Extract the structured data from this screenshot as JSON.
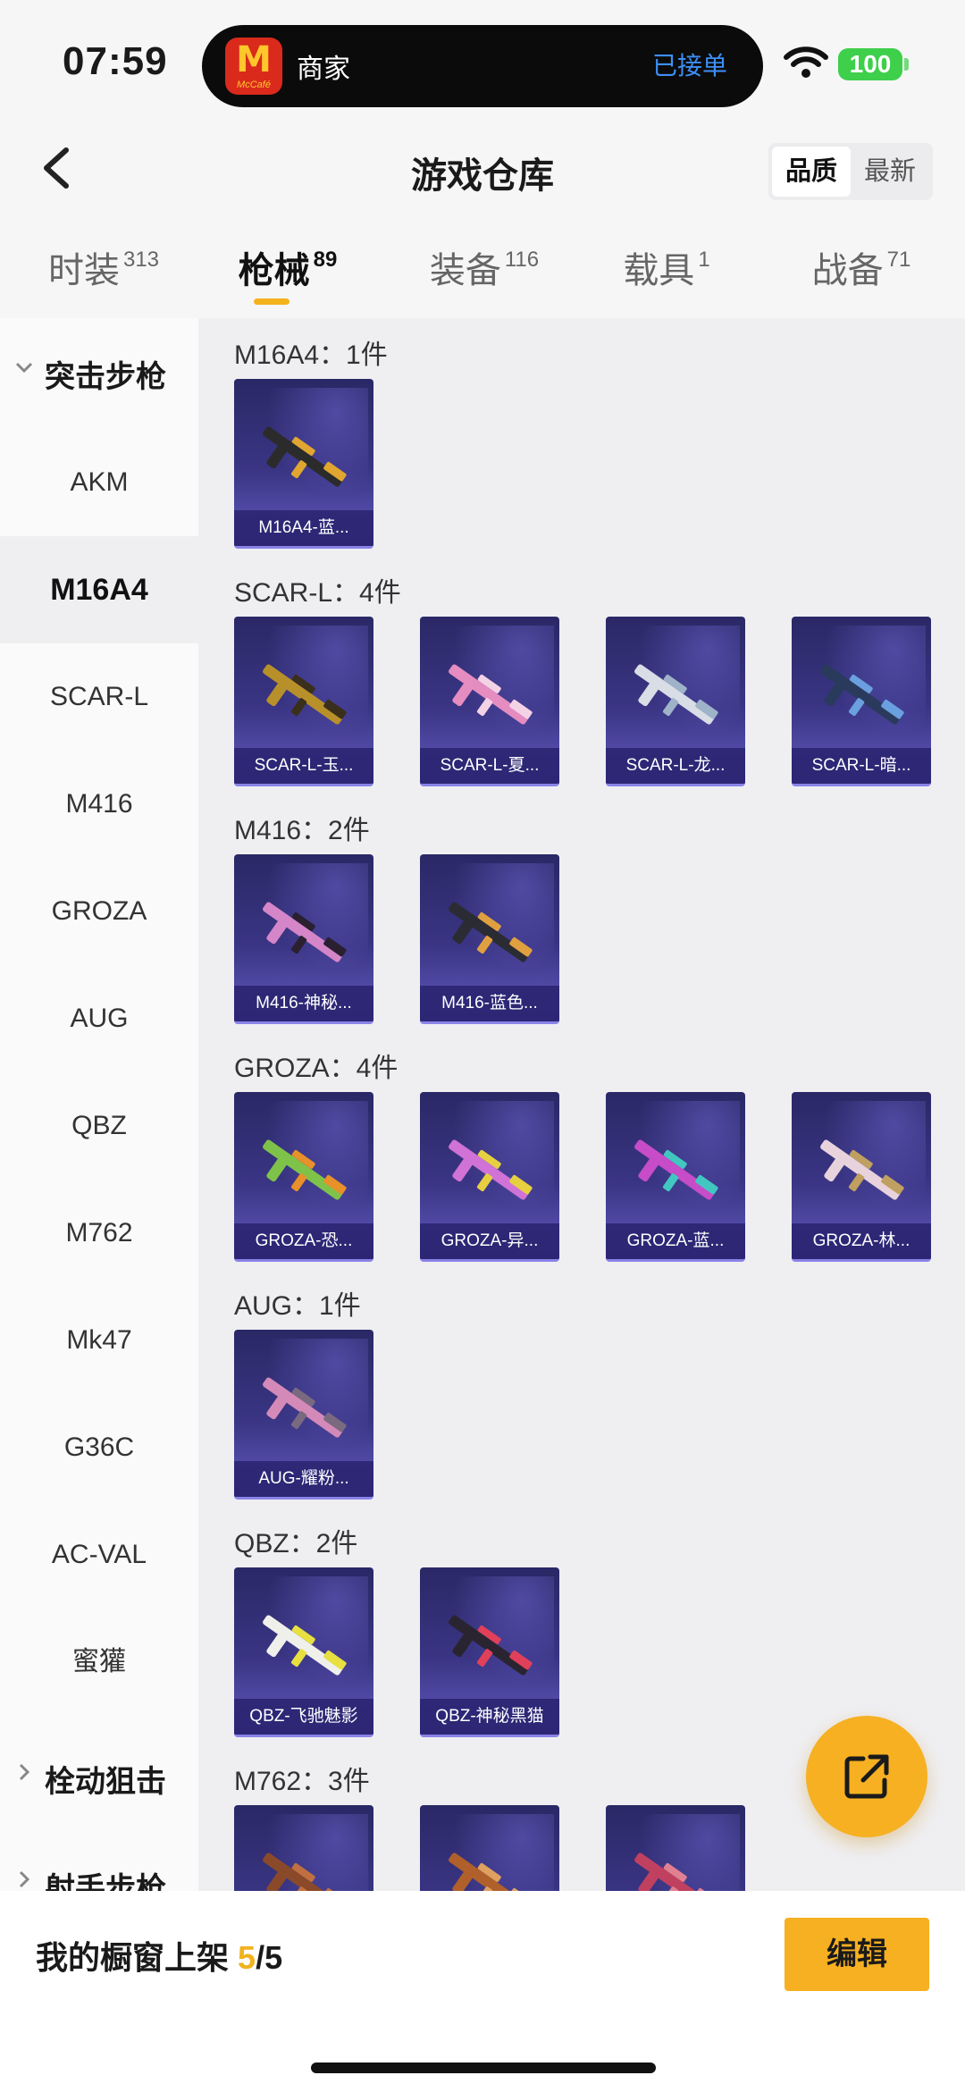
{
  "status_bar": {
    "time": "07:59",
    "island_title": "商家",
    "island_logo_letter": "M",
    "island_logo_sub": "McCafé",
    "island_status": "已接单",
    "battery": "100"
  },
  "header": {
    "title": "游戏仓库",
    "sort_options": [
      "品质",
      "最新"
    ],
    "sort_selected": "品质"
  },
  "tabs": [
    {
      "label": "时装",
      "count": "313"
    },
    {
      "label": "枪械",
      "count": "89"
    },
    {
      "label": "装备",
      "count": "116"
    },
    {
      "label": "载具",
      "count": "1"
    },
    {
      "label": "战备",
      "count": "71"
    }
  ],
  "active_tab": "枪械",
  "sidebar": {
    "category_assault": "突击步枪",
    "items": [
      "AKM",
      "M16A4",
      "SCAR-L",
      "M416",
      "GROZA",
      "AUG",
      "QBZ",
      "M762",
      "Mk47",
      "G36C",
      "AC-VAL",
      "蜜獾"
    ],
    "active_item": "M16A4",
    "category_bolt": "栓动狙击",
    "category_marksman": "射手步枪"
  },
  "groups": [
    {
      "label": "M16A4：1件",
      "items": [
        {
          "name": "M16A4-蓝...",
          "color": "#2b2b2b",
          "accent": "#e0a630"
        }
      ]
    },
    {
      "label": "SCAR-L：4件",
      "items": [
        {
          "name": "SCAR-L-玉...",
          "color": "#b8902a",
          "accent": "#3a2f1a"
        },
        {
          "name": "SCAR-L-夏...",
          "color": "#e58cc0",
          "accent": "#f4d2e6"
        },
        {
          "name": "SCAR-L-龙...",
          "color": "#d8dde6",
          "accent": "#9fb3c8"
        },
        {
          "name": "SCAR-L-暗...",
          "color": "#2a3a5c",
          "accent": "#6aa0e0"
        }
      ]
    },
    {
      "label": "M416：2件",
      "items": [
        {
          "name": "M416-神秘...",
          "color": "#d486c8",
          "accent": "#2a2030"
        },
        {
          "name": "M416-蓝色...",
          "color": "#2b2b33",
          "accent": "#e0a040"
        }
      ]
    },
    {
      "label": "GROZA：4件",
      "items": [
        {
          "name": "GROZA-恐...",
          "color": "#7fc24a",
          "accent": "#e8902a"
        },
        {
          "name": "GROZA-异...",
          "color": "#d072d6",
          "accent": "#e6d040"
        },
        {
          "name": "GROZA-蓝...",
          "color": "#c64cc8",
          "accent": "#40c8c0"
        },
        {
          "name": "GROZA-林...",
          "color": "#e8d2dc",
          "accent": "#c0a060"
        }
      ]
    },
    {
      "label": "AUG：1件",
      "items": [
        {
          "name": "AUG-耀粉...",
          "color": "#d48ab8",
          "accent": "#7a6a80"
        }
      ]
    },
    {
      "label": "QBZ：2件",
      "items": [
        {
          "name": "QBZ-飞驰魅影",
          "color": "#f0f0ea",
          "accent": "#e8e040"
        },
        {
          "name": "QBZ-神秘黑猫",
          "color": "#2a2430",
          "accent": "#e0405a"
        }
      ]
    },
    {
      "label": "M762：3件",
      "items": [
        {
          "name": "",
          "color": "#8a4a2a",
          "accent": "#c07040"
        },
        {
          "name": "",
          "color": "#b0602a",
          "accent": "#e0a060"
        },
        {
          "name": "",
          "color": "#c04060",
          "accent": "#e08090"
        }
      ]
    }
  ],
  "bottom": {
    "showcase_prefix": "我的橱窗上架",
    "showcase_current": "5",
    "showcase_total": "/5",
    "edit_label": "编辑"
  }
}
